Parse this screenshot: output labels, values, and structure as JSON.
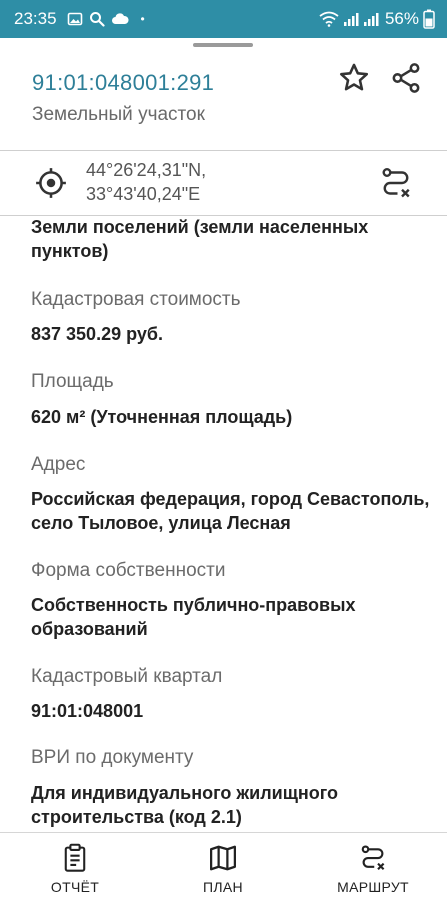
{
  "status_bar": {
    "time": "23:35",
    "battery": "56%",
    "dot": "•"
  },
  "header": {
    "cadastral_number": "91:01:048001:291",
    "object_type": "Земельный участок",
    "favorite_icon": "star-icon",
    "share_icon": "share-icon"
  },
  "coordinates": {
    "lat": "44°26'24,31\"N,",
    "lon": "33°43'40,24\"E",
    "target_icon": "target-icon",
    "route_icon": "route-icon"
  },
  "fields": {
    "category_value": "Земли поселений (земли населенных пунктов)",
    "cost_label": "Кадастровая стоимость",
    "cost_value": "837 350.29 руб.",
    "area_label": "Площадь",
    "area_value": "620 м² (Уточненная площадь)",
    "address_label": "Адрес",
    "address_value": "Российская федерация, город Севастополь, село Тыловое, улица Лесная",
    "ownership_label": "Форма собственности",
    "ownership_value": "Собственность публично-правовых образований",
    "quarter_label": "Кадастровый квартал",
    "quarter_value": "91:01:048001",
    "vri_label": "ВРИ по документу",
    "vri_value": "Для индивидуального жилищного строительства (код 2.1)"
  },
  "bottom_nav": {
    "report": "ОТЧЁТ",
    "plan": "ПЛАН",
    "route": "МАРШРУТ"
  },
  "colors": {
    "accent": "#2e8ea6",
    "link": "#2e7f98"
  }
}
